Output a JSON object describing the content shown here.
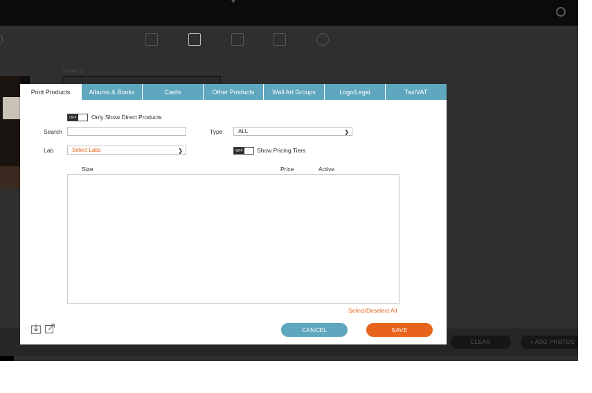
{
  "background": {
    "room_label": "Room 2",
    "clear_label": "CLEAR",
    "add_photos_label": "+ ADD PHOTOS"
  },
  "modal": {
    "tabs": [
      {
        "label": "Print Products",
        "active": true
      },
      {
        "label": "Albums & Books",
        "active": false
      },
      {
        "label": "Cards",
        "active": false
      },
      {
        "label": "Other Products",
        "active": false
      },
      {
        "label": "Wall Art Groups",
        "active": false
      },
      {
        "label": "Logo/Legal",
        "active": false
      },
      {
        "label": "Tax/VAT",
        "active": false
      }
    ],
    "direct_products_toggle": {
      "state": "OFF",
      "label": "Only Show Direct Products"
    },
    "search": {
      "label": "Search",
      "value": ""
    },
    "type": {
      "label": "Type",
      "value": "ALL"
    },
    "lab": {
      "label": "Lab",
      "value": "Select Labs"
    },
    "pricing_tiers_toggle": {
      "state": "OFF",
      "label": "Show Pricing Tiers"
    },
    "columns": {
      "size": "Size",
      "price": "Price",
      "active": "Active"
    },
    "select_all_label": "Select/Deselect All",
    "cancel_label": "CANCEL",
    "save_label": "SAVE"
  },
  "colors": {
    "accent_blue": "#5fa6bf",
    "accent_orange": "#e8641c"
  },
  "icons": [
    "gear-icon",
    "download-icon",
    "export-icon",
    "chevron-right-icon"
  ]
}
